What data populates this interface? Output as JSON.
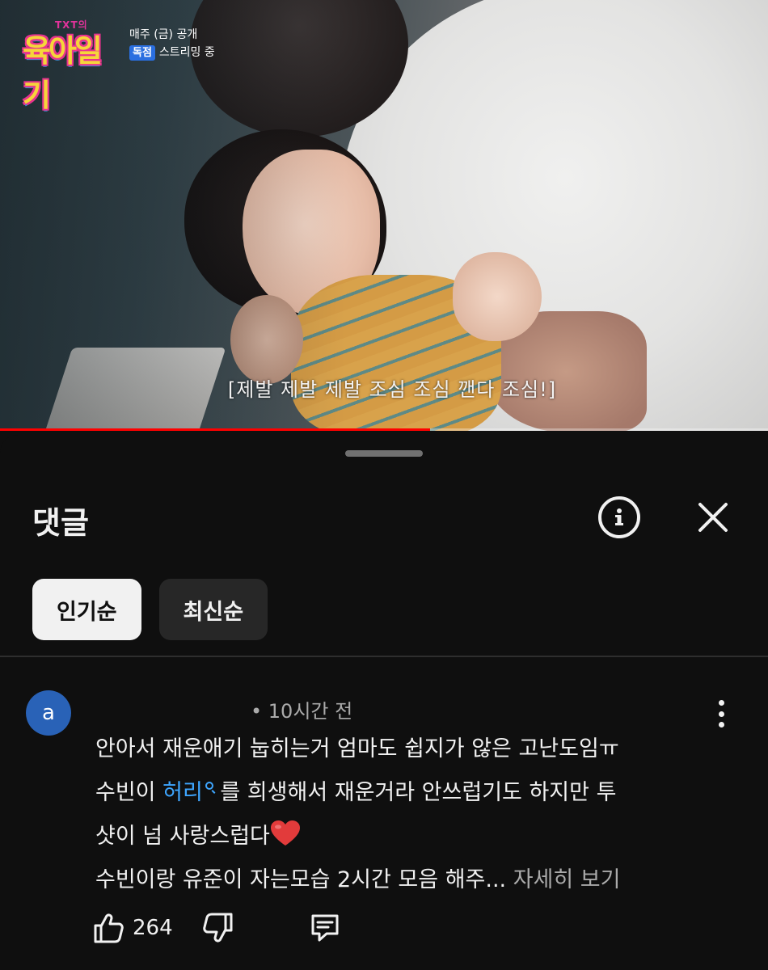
{
  "video": {
    "logo": {
      "top_text": "TXT의",
      "main_text": "육아일기"
    },
    "promo": {
      "line1": "매주 (금) 공개",
      "badge": "독점",
      "line2": "스트리밍 중"
    },
    "subtitle": "[제발 제발 제발 조심 조심 깬다 조심!]",
    "progress_fraction": 0.56
  },
  "sheet": {
    "title": "댓글",
    "chips": [
      {
        "label": "인기순",
        "selected": true
      },
      {
        "label": "최신순",
        "selected": false
      }
    ]
  },
  "comment": {
    "avatar_letter": "a",
    "time": "• 10시간 전",
    "lines": {
      "l1": "안아서 재운애기 눕히는거 엄마도 쉽지가 않은 고난도임ㅠ",
      "l2_pre": "수빈이 ",
      "l2_link": "허리",
      "l2_post": " 를 희생해서 재운거라 안쓰럽기도 하지만 투",
      "l3": "샷이 넘 사랑스럽다",
      "l4": "수빈이랑 유준이 자는모습 2시간 모음 해주... ",
      "more": "자세히 보기"
    },
    "likes": "264"
  },
  "colors": {
    "background": "#0f0f0f",
    "link": "#3ea6ff",
    "avatar": "#2962b7",
    "heart": "#e23b3b"
  }
}
